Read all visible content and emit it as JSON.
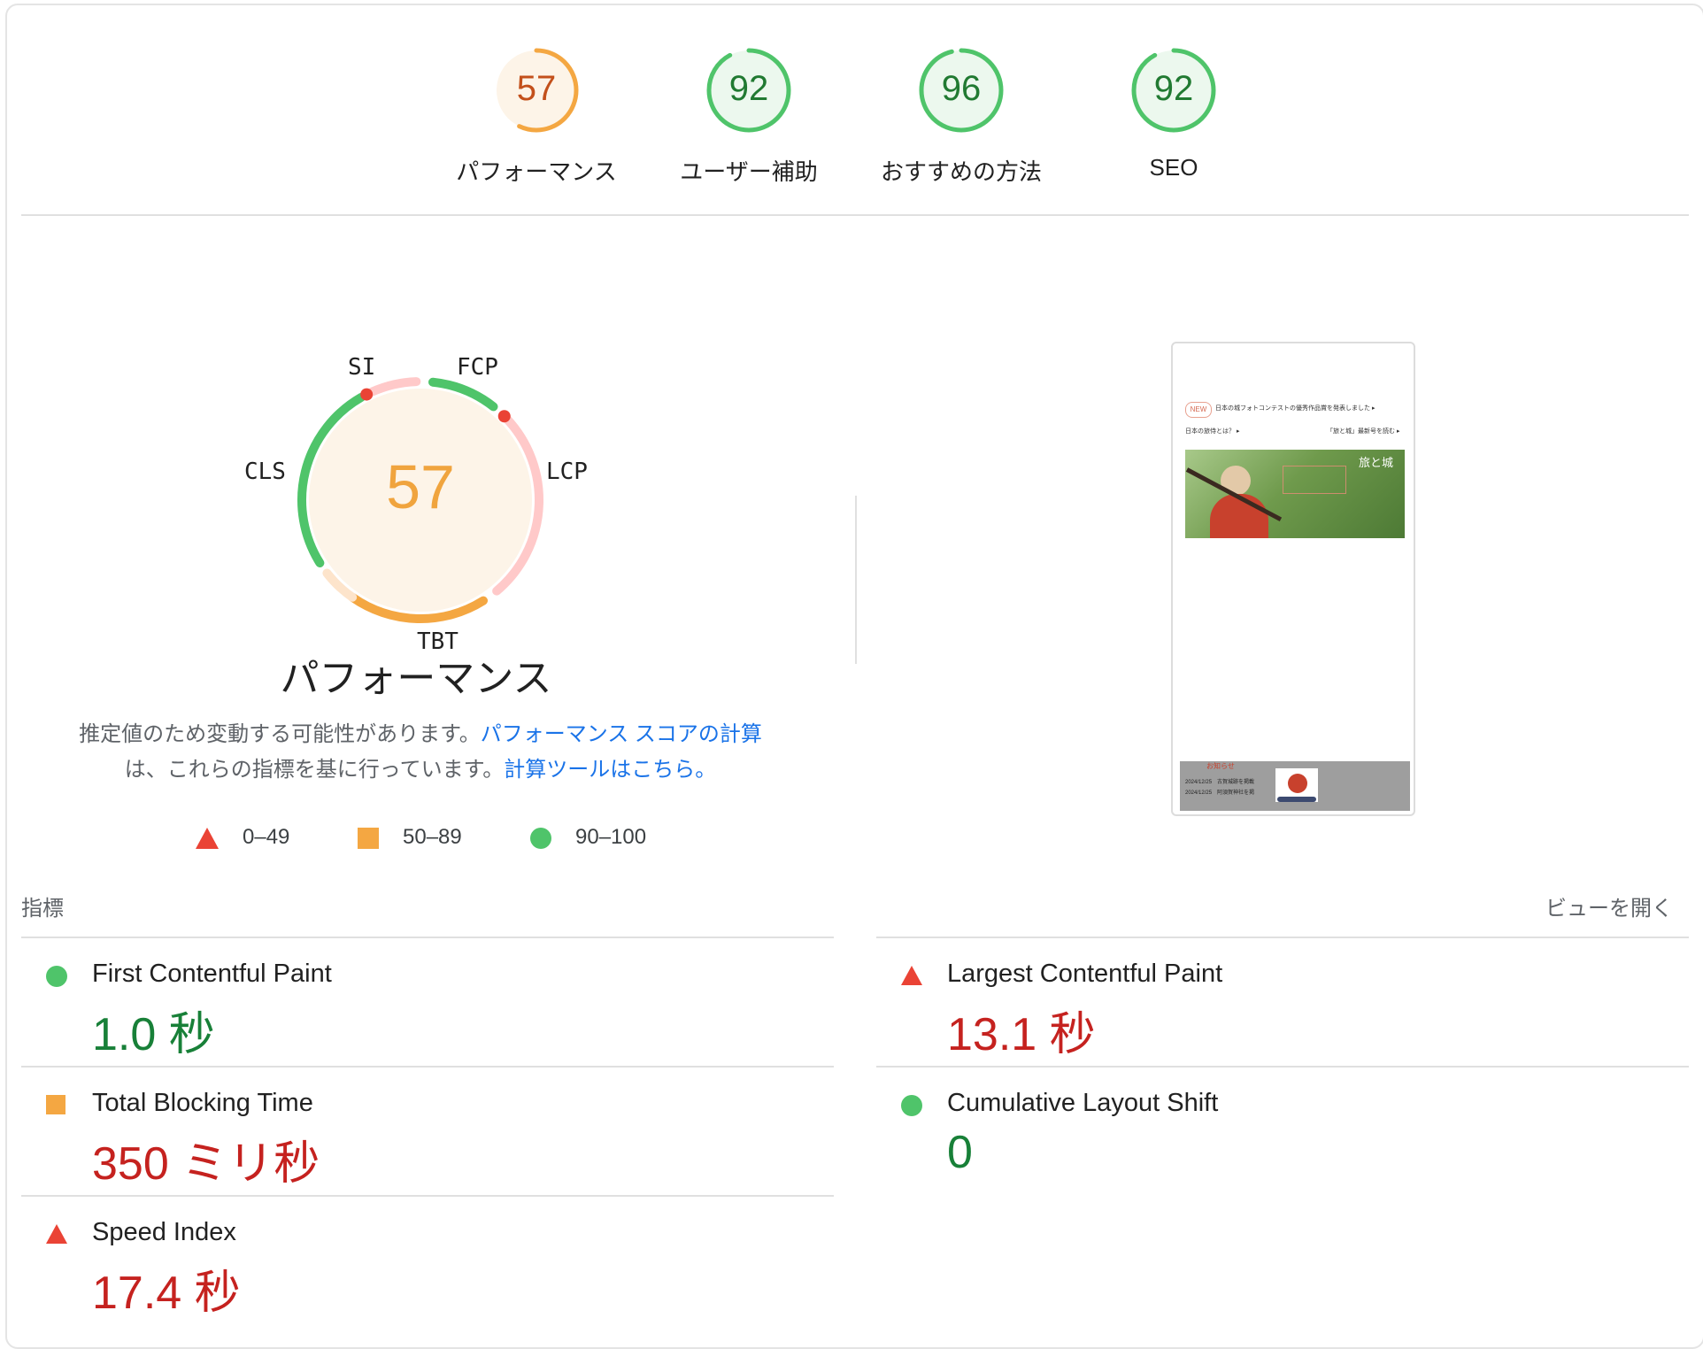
{
  "categories": [
    {
      "score": "57",
      "label": "パフォーマンス",
      "fraction": 0.57,
      "color": "#f4a742",
      "bg": "#fdf4e8",
      "text_color": "#c3501b"
    },
    {
      "score": "92",
      "label": "ユーザー補助",
      "fraction": 0.92,
      "color": "#4fc46a",
      "bg": "#ecf8ee",
      "text_color": "#217a32"
    },
    {
      "score": "96",
      "label": "おすすめの方法",
      "fraction": 0.96,
      "color": "#4fc46a",
      "bg": "#ecf8ee",
      "text_color": "#217a32"
    },
    {
      "score": "92",
      "label": "SEO",
      "fraction": 0.92,
      "color": "#4fc46a",
      "bg": "#ecf8ee",
      "text_color": "#217a32"
    }
  ],
  "perf": {
    "score": "57",
    "title": "パフォーマンス",
    "dial_labels": {
      "si": "SI",
      "fcp": "FCP",
      "lcp": "LCP",
      "tbt": "TBT",
      "cls": "CLS"
    },
    "desc_1": "推定値のため変動する可能性があります。",
    "desc_link_1": "パフォーマンス スコアの計算",
    "desc_2": "は、これらの指標を基に行っています。",
    "desc_link_2": "計算ツールはこちら。"
  },
  "legend": [
    "0–49",
    "50–89",
    "90–100"
  ],
  "metrics_header": {
    "label": "指標",
    "expand": "ビューを開く"
  },
  "metrics": [
    {
      "name": "First Contentful Paint",
      "value": "1.0 秒",
      "status": "pass"
    },
    {
      "name": "Largest Contentful Paint",
      "value": "13.1 秒",
      "status": "fail"
    },
    {
      "name": "Total Blocking Time",
      "value": "350 ミリ秒",
      "status": "average"
    },
    {
      "name": "Cumulative Layout Shift",
      "value": "0",
      "status": "pass"
    },
    {
      "name": "Speed Index",
      "value": "17.4 秒",
      "status": "fail"
    }
  ],
  "screenshot": {
    "badge": "NEW",
    "line1": "日本の城フォトコンテストの優秀作品賞を発表しました ▸",
    "line2_left": "日本の旅侍とは？ ▸",
    "line2_right": "「旅と城」最新号を読む ▸",
    "banner_title": "旅と城",
    "news_title": "お知らせ",
    "news_1": "2024/12/25　古賀城跡を掲載",
    "news_2": "2024/12/25　阿須賀神社を掲",
    "colors": {
      "banner_green": "#6f9a4c",
      "robe": "#c8412d",
      "news_bg": "#9e9e9e"
    }
  },
  "colors": {
    "orange": "#f4a742",
    "green": "#4fc46a",
    "red": "#ea4335",
    "pink": "#ffc9c9",
    "peach": "#fde4cb",
    "link": "#1a73e8"
  }
}
